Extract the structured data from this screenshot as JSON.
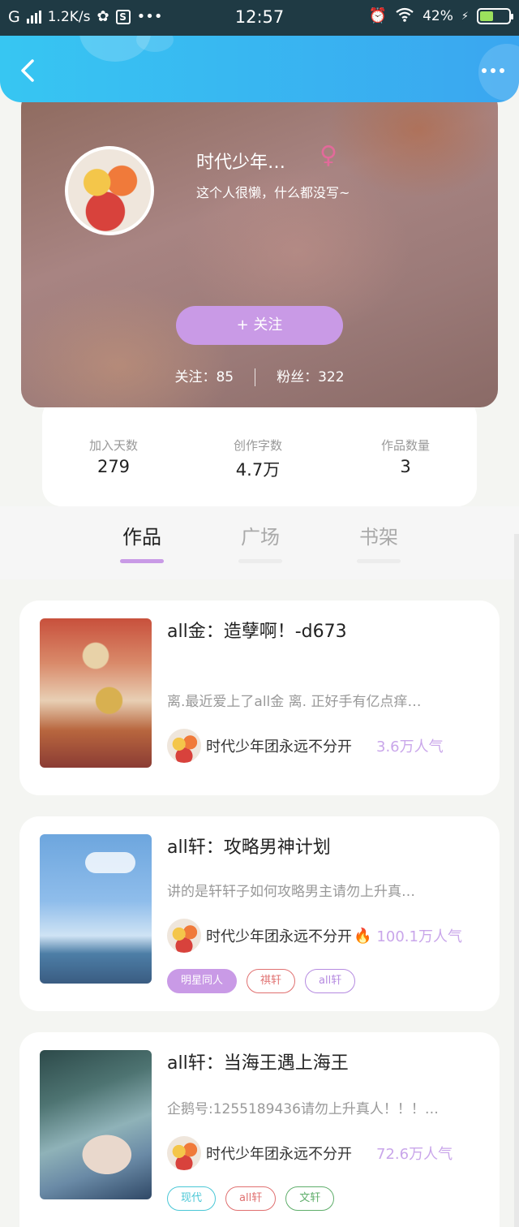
{
  "status_bar": {
    "network": "G",
    "speed": "1.2K/s",
    "time": "12:57",
    "battery": "42%"
  },
  "header": {
    "back_icon": "chevron-left-icon",
    "more_icon": "more-dots-icon"
  },
  "profile": {
    "nickname": "时代少年…",
    "gender_symbol": "♀",
    "bio": "这个人很懒，什么都没写~",
    "follow_button": "+  关注",
    "following_label": "关注：",
    "following_count": "85",
    "fans_label": "粉丝：",
    "fans_count": "322"
  },
  "stats": [
    {
      "label": "加入天数",
      "value": "279"
    },
    {
      "label": "创作字数",
      "value": "4.7万"
    },
    {
      "label": "作品数量",
      "value": "3"
    }
  ],
  "tabs": [
    {
      "label": "作品",
      "active": true
    },
    {
      "label": "广场",
      "active": false
    },
    {
      "label": "书架",
      "active": false
    }
  ],
  "works": [
    {
      "title": "all金：造孽啊！-d673",
      "description": "离.最近爱上了all金 离. 正好手有亿点痒…",
      "author": "时代少年团永远不分开",
      "popularity": "3.6万人气",
      "tags": []
    },
    {
      "title": "all轩：攻略男神计划",
      "description": "讲的是轩轩子如何攻略男主请勿上升真…",
      "author": "时代少年团永远不分开",
      "popularity": "100.1万人气",
      "tags": [
        "明星同人",
        "祺轩",
        "all轩"
      ]
    },
    {
      "title": "all轩：当海王遇上海王",
      "description": "企鹅号:1255189436请勿上升真人！！！…",
      "author": "时代少年团永远不分开",
      "popularity": "72.6万人气",
      "tags": [
        "现代",
        "all轩",
        "文轩"
      ]
    }
  ],
  "colors": {
    "accent": "#c99ae6",
    "header": "#3aa6f0",
    "status_bar": "#1f3a44"
  }
}
